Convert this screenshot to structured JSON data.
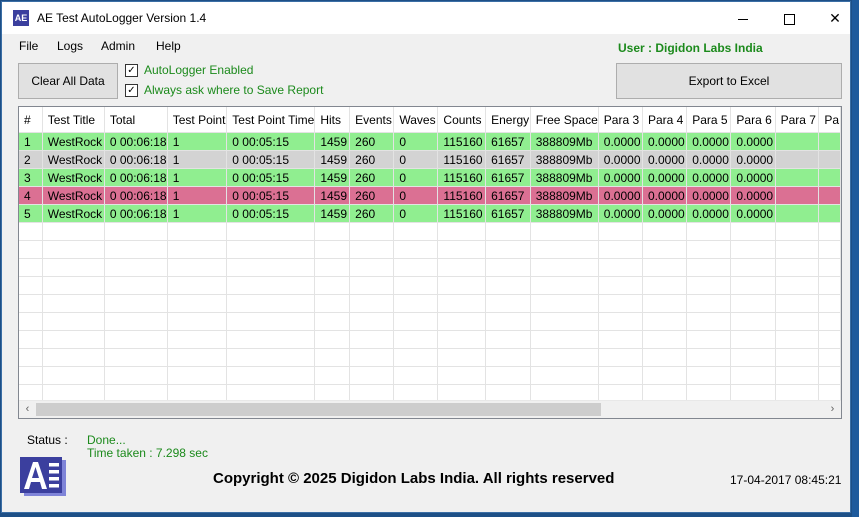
{
  "window": {
    "title": "AE Test AutoLogger Version 1.4",
    "icon_text": "AE",
    "controls": {
      "minimize": "—",
      "maximize": "□",
      "close": "✕"
    }
  },
  "menu": [
    "File",
    "Logs",
    "Admin",
    "Help"
  ],
  "user_label": "User : Digidon Labs India",
  "buttons": {
    "clear": "Clear All Data",
    "export": "Export to Excel"
  },
  "options": [
    {
      "label": "AutoLogger Enabled",
      "checked": true
    },
    {
      "label": "Always ask where to Save Report",
      "checked": true
    }
  ],
  "grid": {
    "columns": [
      "#",
      "Test Title",
      "Total",
      "Test Point",
      "Test Point Time",
      "Hits",
      "Events",
      "Waves",
      "Counts",
      "Energy",
      "Free Space",
      "Para 3",
      "Para 4",
      "Para 5",
      "Para 6",
      "Para 7",
      "Pa"
    ],
    "rows": [
      {
        "status": "green",
        "cells": [
          "1",
          "WestRock",
          "0 00:06:18",
          "1",
          "0 00:05:15",
          "1459",
          "260",
          "0",
          "115160",
          "61657",
          "388809Mb",
          "0.0000",
          "0.0000",
          "0.0000",
          "0.0000",
          "",
          ""
        ]
      },
      {
        "status": "gray",
        "cells": [
          "2",
          "WestRock",
          "0 00:06:18",
          "1",
          "0 00:05:15",
          "1459",
          "260",
          "0",
          "115160",
          "61657",
          "388809Mb",
          "0.0000",
          "0.0000",
          "0.0000",
          "0.0000",
          "",
          ""
        ]
      },
      {
        "status": "green",
        "cells": [
          "3",
          "WestRock",
          "0 00:06:18",
          "1",
          "0 00:05:15",
          "1459",
          "260",
          "0",
          "115160",
          "61657",
          "388809Mb",
          "0.0000",
          "0.0000",
          "0.0000",
          "0.0000",
          "",
          ""
        ]
      },
      {
        "status": "red",
        "cells": [
          "4",
          "WestRock",
          "0 00:06:18",
          "1",
          "0 00:05:15",
          "1459",
          "260",
          "0",
          "115160",
          "61657",
          "388809Mb",
          "0.0000",
          "0.0000",
          "0.0000",
          "0.0000",
          "",
          ""
        ]
      },
      {
        "status": "green",
        "cells": [
          "5",
          "WestRock",
          "0 00:06:18",
          "1",
          "0 00:05:15",
          "1459",
          "260",
          "0",
          "115160",
          "61657",
          "388809Mb",
          "0.0000",
          "0.0000",
          "0.0000",
          "0.0000",
          "",
          ""
        ]
      }
    ],
    "empty_rows": 10,
    "row_colors": {
      "green": "#90ee90",
      "gray": "#d3d3d3",
      "red": "#db7093"
    },
    "scroll": {
      "left": "‹",
      "right": "›"
    }
  },
  "status": {
    "label": "Status :",
    "value": "Done...",
    "time_taken": "Time taken : 7.298 sec"
  },
  "footer": {
    "logo_text": "AE",
    "copyright": "Copyright © 2025 Digidon Labs India. All rights reserved",
    "datetime": "17-04-2017 08:45:21"
  },
  "colors": {
    "accent_green": "#1c8a1c",
    "logo_blue": "#3b3f9e"
  }
}
